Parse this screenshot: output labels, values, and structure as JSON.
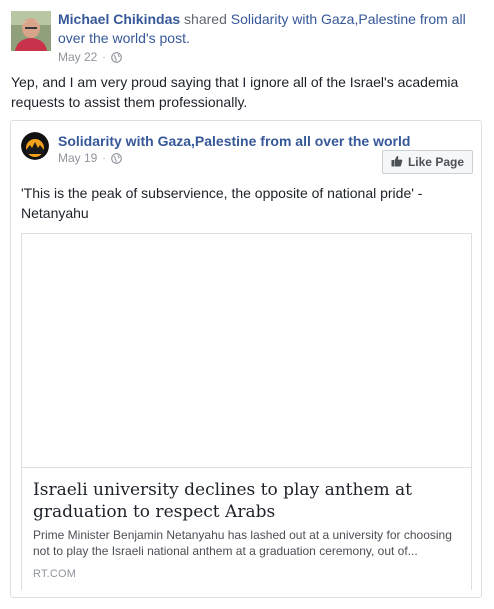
{
  "post": {
    "author": "Michael Chikindas",
    "action": "shared",
    "shared_owner": "Solidarity with Gaza,Palestine from all over the world",
    "shared_suffix": "'s post.",
    "date": "May 22",
    "separator": "·",
    "privacy_icon": "globe-icon",
    "text": "Yep, and I am very proud saying that I ignore all of the Israel's academia requests to assist them professionally."
  },
  "shared": {
    "page_name": "Solidarity with Gaza,Palestine from all over the world",
    "date": "May 19",
    "separator": "·",
    "privacy_icon": "globe-icon",
    "like_button": "Like Page",
    "like_icon": "thumbs-up-icon",
    "text": "'This is the peak of subservience, the opposite of national pride' - Netanyahu",
    "link": {
      "title": "Israeli university declines to play anthem at graduation to respect Arabs",
      "description": "Prime Minister Benjamin Netanyahu has lashed out at a university for choosing not to play the Israeli national anthem at a graduation ceremony, out of...",
      "domain": "RT.COM"
    }
  },
  "colors": {
    "link": "#365899",
    "text": "#1d2129",
    "meta": "#90949c",
    "border": "#dddfe2"
  }
}
